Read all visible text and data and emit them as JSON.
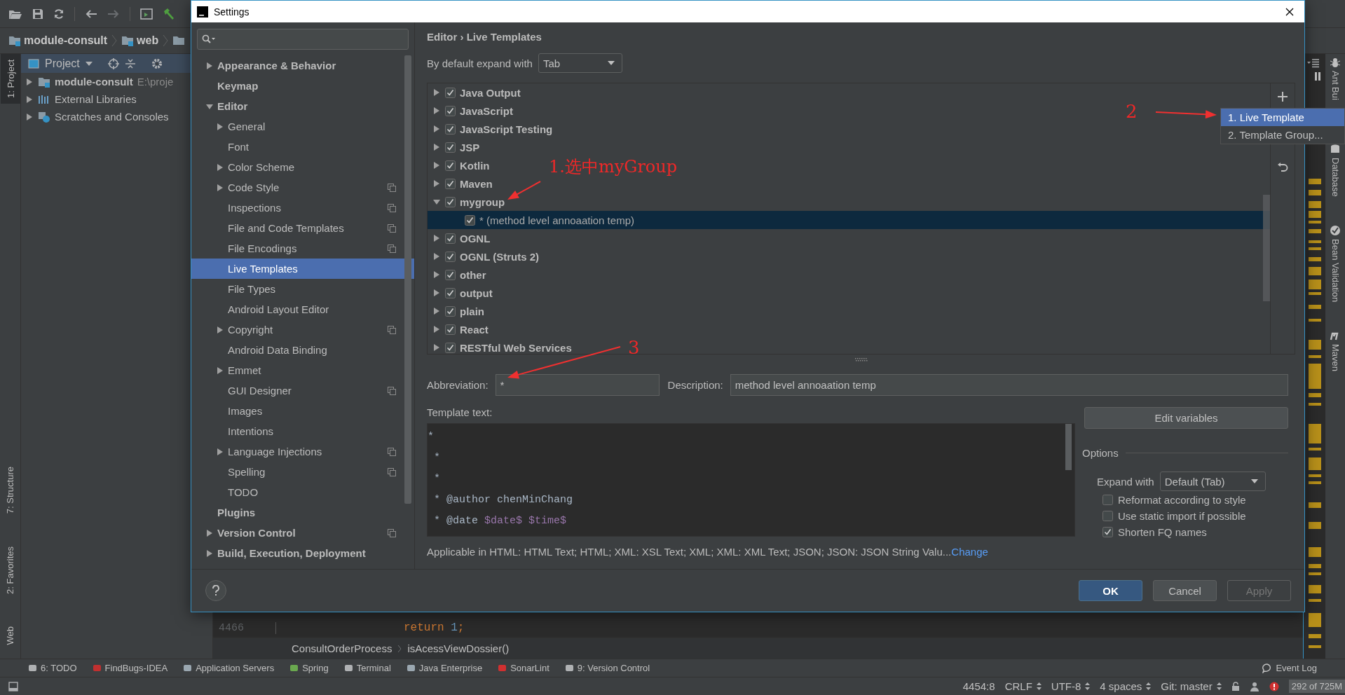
{
  "ide": {
    "breadcrumb": [
      {
        "label": "module-consult"
      },
      {
        "label": "web"
      }
    ],
    "left_stripe": [
      {
        "label": "1: Project",
        "selected": true
      },
      {
        "label": "7: Structure",
        "selected": false
      },
      {
        "label": "2: Favorites",
        "selected": false
      },
      {
        "label": "Web",
        "selected": false
      }
    ],
    "project_panel": {
      "title": "Project",
      "tree": [
        {
          "label": "module-consult",
          "path": "E:\\proje",
          "kind": "module"
        },
        {
          "label": "External Libraries",
          "kind": "libraries"
        },
        {
          "label": "Scratches and Consoles",
          "kind": "scratches"
        }
      ]
    },
    "editor": {
      "line_number": "4466",
      "code": [
        {
          "text": "return",
          "kind": "keyword"
        },
        {
          "text": " 1",
          "kind": "number"
        },
        {
          "text": ";",
          "kind": "keyword"
        }
      ],
      "breadcrumb": [
        "ConsultOrderProcess",
        "isAcessViewDossier()"
      ]
    },
    "right_stripe": [
      {
        "label": "Ant Bui",
        "kind": "ant"
      },
      {
        "label": "Database",
        "kind": "database"
      },
      {
        "label": "Bean Validation",
        "kind": "bean"
      },
      {
        "label": "Maven",
        "kind": "maven"
      }
    ],
    "tool_windows": [
      {
        "label": "6: TODO",
        "kind": "todo"
      },
      {
        "label": "FindBugs-IDEA",
        "kind": "bug"
      },
      {
        "label": "Application Servers",
        "kind": "server"
      },
      {
        "label": "Spring",
        "kind": "spring"
      },
      {
        "label": "Terminal",
        "kind": "terminal"
      },
      {
        "label": "Java Enterprise",
        "kind": "enterprise"
      },
      {
        "label": "SonarLint",
        "kind": "sonar"
      },
      {
        "label": "9: Version Control",
        "kind": "vcs"
      }
    ],
    "event_log": "Event Log",
    "status_bar": {
      "position": "4454:8",
      "items": [
        "CRLF",
        "UTF-8",
        "4 spaces",
        "Git: master"
      ],
      "memory": "292 of 725M"
    }
  },
  "settings": {
    "title": "Settings",
    "tree": [
      {
        "label": "Appearance & Behavior",
        "kind": "branch",
        "expanded": false,
        "selected": false,
        "project_level": false
      },
      {
        "label": "Keymap",
        "kind": "leaf",
        "selected": false,
        "project_level": false
      },
      {
        "label": "Editor",
        "kind": "branch",
        "expanded": true,
        "selected": false,
        "project_level": false,
        "children": [
          {
            "label": "General",
            "kind": "branch",
            "expanded": false,
            "selected": false,
            "project_level": false
          },
          {
            "label": "Font",
            "kind": "leaf",
            "selected": false,
            "project_level": false
          },
          {
            "label": "Color Scheme",
            "kind": "branch",
            "expanded": false,
            "selected": false,
            "project_level": false
          },
          {
            "label": "Code Style",
            "kind": "branch",
            "expanded": false,
            "selected": false,
            "project_level": true
          },
          {
            "label": "Inspections",
            "kind": "leaf",
            "selected": false,
            "project_level": true
          },
          {
            "label": "File and Code Templates",
            "kind": "leaf",
            "selected": false,
            "project_level": true
          },
          {
            "label": "File Encodings",
            "kind": "leaf",
            "selected": false,
            "project_level": true
          },
          {
            "label": "Live Templates",
            "kind": "leaf",
            "selected": true,
            "project_level": false
          },
          {
            "label": "File Types",
            "kind": "leaf",
            "selected": false,
            "project_level": false
          },
          {
            "label": "Android Layout Editor",
            "kind": "leaf",
            "selected": false,
            "project_level": false
          },
          {
            "label": "Copyright",
            "kind": "branch",
            "expanded": false,
            "selected": false,
            "project_level": true
          },
          {
            "label": "Android Data Binding",
            "kind": "leaf",
            "selected": false,
            "project_level": false
          },
          {
            "label": "Emmet",
            "kind": "branch",
            "expanded": false,
            "selected": false,
            "project_level": false
          },
          {
            "label": "GUI Designer",
            "kind": "leaf",
            "selected": false,
            "project_level": true
          },
          {
            "label": "Images",
            "kind": "leaf",
            "selected": false,
            "project_level": false
          },
          {
            "label": "Intentions",
            "kind": "leaf",
            "selected": false,
            "project_level": false
          },
          {
            "label": "Language Injections",
            "kind": "branch",
            "expanded": false,
            "selected": false,
            "project_level": true
          },
          {
            "label": "Spelling",
            "kind": "leaf",
            "selected": false,
            "project_level": true
          },
          {
            "label": "TODO",
            "kind": "leaf",
            "selected": false,
            "project_level": false
          }
        ]
      },
      {
        "label": "Plugins",
        "kind": "leaf",
        "selected": false,
        "project_level": false
      },
      {
        "label": "Version Control",
        "kind": "branch",
        "expanded": false,
        "selected": false,
        "project_level": true
      },
      {
        "label": "Build, Execution, Deployment",
        "kind": "branch",
        "expanded": false,
        "selected": false,
        "project_level": false
      }
    ],
    "breadcrumb": "Editor › Live Templates",
    "default_expand_label": "By default expand with",
    "default_expand_value": "Tab",
    "groups": [
      {
        "label": "Java Output",
        "checked": true,
        "expanded": false,
        "selected": false
      },
      {
        "label": "JavaScript",
        "checked": true,
        "expanded": false,
        "selected": false
      },
      {
        "label": "JavaScript Testing",
        "checked": true,
        "expanded": false,
        "selected": false
      },
      {
        "label": "JSP",
        "checked": true,
        "expanded": false,
        "selected": false
      },
      {
        "label": "Kotlin",
        "checked": true,
        "expanded": false,
        "selected": false
      },
      {
        "label": "Maven",
        "checked": true,
        "expanded": false,
        "selected": false
      },
      {
        "label": "mygroup",
        "checked": true,
        "expanded": true,
        "selected": false,
        "children": [
          {
            "label": "* (method level annoaation temp)",
            "checked": true,
            "selected": true
          }
        ]
      },
      {
        "label": "OGNL",
        "checked": true,
        "expanded": false,
        "selected": false
      },
      {
        "label": "OGNL (Struts 2)",
        "checked": true,
        "expanded": false,
        "selected": false
      },
      {
        "label": "other",
        "checked": true,
        "expanded": false,
        "selected": false
      },
      {
        "label": "output",
        "checked": true,
        "expanded": false,
        "selected": false
      },
      {
        "label": "plain",
        "checked": true,
        "expanded": false,
        "selected": false
      },
      {
        "label": "React",
        "checked": true,
        "expanded": false,
        "selected": false
      },
      {
        "label": "RESTful Web Services",
        "checked": true,
        "expanded": false,
        "selected": false
      }
    ],
    "add_menu": [
      {
        "label": "1. Live Template",
        "selected": true
      },
      {
        "label": "2. Template Group...",
        "selected": false
      }
    ],
    "abbreviation_label": "Abbreviation:",
    "abbreviation": "*",
    "description_label": "Description:",
    "description": "method level annoaation temp",
    "template_label": "Template text:",
    "template_lines": [
      [
        {
          "text": "*",
          "kind": "text"
        }
      ],
      [
        {
          "text": " *",
          "kind": "text"
        }
      ],
      [
        {
          "text": " *",
          "kind": "text"
        }
      ],
      [
        {
          "text": " * @author chenMinChang",
          "kind": "text"
        }
      ],
      [
        {
          "text": " * @date ",
          "kind": "text"
        },
        {
          "text": "$date$",
          "kind": "variable"
        },
        {
          "text": " $time$",
          "kind": "variable"
        }
      ]
    ],
    "edit_variables": "Edit variables",
    "options_title": "Options",
    "expand_with_label": "Expand with",
    "expand_with_value": "Default (Tab)",
    "options": [
      {
        "label": "Reformat according to style",
        "checked": false
      },
      {
        "label": "Use static import if possible",
        "checked": false
      },
      {
        "label": "Shorten FQ names",
        "checked": true
      }
    ],
    "applicable": "Applicable in HTML: HTML Text; HTML; XML: XSL Text; XML; XML: XML Text; JSON; JSON: JSON String Valu...",
    "change_link": "Change",
    "buttons": [
      {
        "label": "OK",
        "default": true,
        "disabled": false
      },
      {
        "label": "Cancel",
        "default": false,
        "disabled": false
      },
      {
        "label": "Apply",
        "default": false,
        "disabled": true
      }
    ]
  },
  "annotations": [
    {
      "text": "1.选中myGroup"
    },
    {
      "text": "2"
    },
    {
      "text": "3"
    }
  ]
}
